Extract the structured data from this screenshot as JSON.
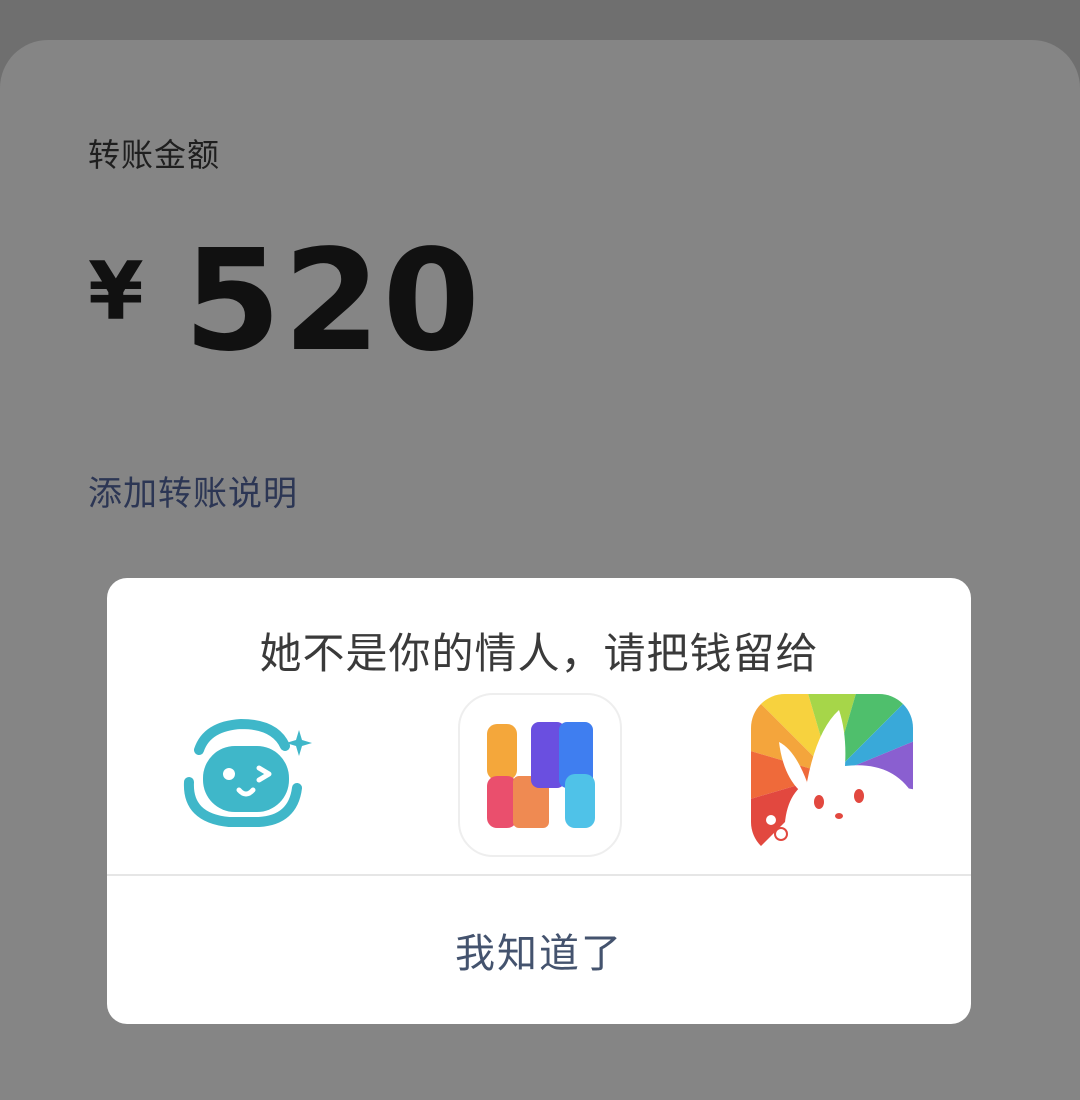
{
  "transfer": {
    "amount_label": "转账金额",
    "currency_symbol": "¥",
    "amount": "520",
    "add_note_link": "添加转账说明"
  },
  "dialog": {
    "message": "她不是你的情人，请把钱留给",
    "apps": [
      {
        "icon": "chat-robot-app-icon"
      },
      {
        "icon": "colorful-blocks-app-icon"
      },
      {
        "icon": "rainbow-bunny-app-icon"
      }
    ],
    "confirm_button": "我知道了"
  },
  "colors": {
    "backdrop": "#6f6f6f",
    "card": "#858585",
    "link": "#2c3654",
    "button_text": "#44536e",
    "teal": "#3fb7c9"
  }
}
